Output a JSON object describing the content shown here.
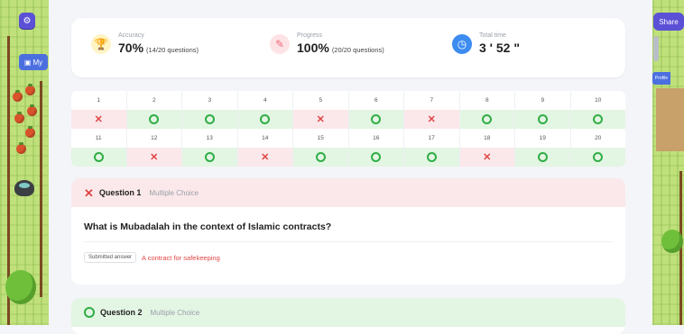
{
  "game": {
    "left_button_icon": "gear-icon",
    "my_button_label": "My",
    "share_label": "Share",
    "profile_label": "Profile"
  },
  "stats": {
    "accuracy": {
      "label": "Accuracy",
      "value": "70%",
      "detail": "(14/20 questions)",
      "icon": "trophy-icon",
      "color": "#f5c518"
    },
    "progress": {
      "label": "Progress",
      "value": "100%",
      "detail": "(20/20 questions)",
      "icon": "pencil-icon",
      "color": "#f06a7a"
    },
    "time": {
      "label": "Total time",
      "value": "3 ' 52 \"",
      "icon": "clock-icon",
      "color": "#3d8cf0"
    }
  },
  "results": {
    "rows": [
      {
        "numbers": [
          "1",
          "2",
          "3",
          "4",
          "5",
          "6",
          "7",
          "8",
          "9",
          "10"
        ],
        "marks": [
          "wrong",
          "right",
          "right",
          "right",
          "wrong",
          "right",
          "wrong",
          "right",
          "right",
          "right"
        ]
      },
      {
        "numbers": [
          "11",
          "12",
          "13",
          "14",
          "15",
          "16",
          "17",
          "18",
          "19",
          "20"
        ],
        "marks": [
          "right",
          "wrong",
          "right",
          "wrong",
          "right",
          "right",
          "right",
          "wrong",
          "right",
          "right"
        ]
      }
    ]
  },
  "questions": [
    {
      "label": "Question 1",
      "type": "Multiple Choice",
      "status": "wrong",
      "text": "What is Mubadalah in the context of Islamic contracts?",
      "submitted_label": "Submitted answer",
      "submitted_answer": "A contract for safekeeping"
    },
    {
      "label": "Question 2",
      "type": "Multiple Choice",
      "status": "right"
    }
  ],
  "colors": {
    "wrong": "#e04545",
    "right": "#2fae45",
    "accent": "#5b50d6"
  }
}
